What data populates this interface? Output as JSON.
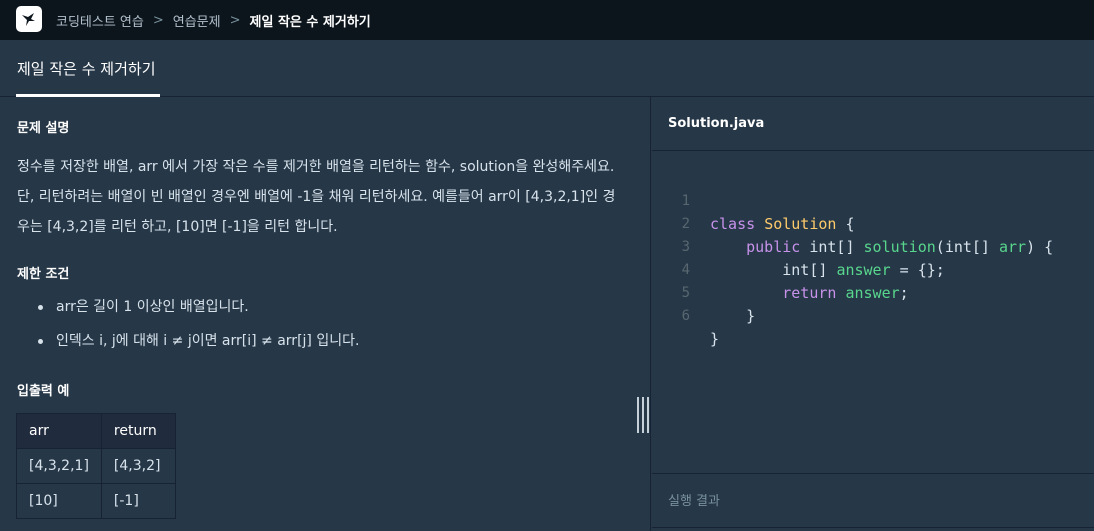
{
  "nav": {
    "breadcrumbs": [
      "코딩테스트 연습",
      "연습문제",
      "제일 작은 수 제거하기"
    ],
    "separator": ">"
  },
  "title_tab": "제일 작은 수 제거하기",
  "problem": {
    "description_heading": "문제 설명",
    "description": "정수를 저장한 배열, arr 에서 가장 작은 수를 제거한 배열을 리턴하는 함수, solution을 완성해주세요. 단, 리턴하려는 배열이 빈 배열인 경우엔 배열에 -1을 채워 리턴하세요. 예를들어 arr이 [4,3,2,1]인 경우는 [4,3,2]를 리턴 하고, [10]면 [-1]을 리턴 합니다.",
    "constraints_heading": "제한 조건",
    "constraints": [
      "arr은 길이 1 이상인 배열입니다.",
      "인덱스 i, j에 대해 i ≠ j이면 arr[i] ≠ arr[j] 입니다."
    ],
    "examples_heading": "입출력 예",
    "examples_table": {
      "headers": [
        "arr",
        "return"
      ],
      "rows": [
        [
          "[4,3,2,1]",
          "[4,3,2]"
        ],
        [
          "[10]",
          "[-1]"
        ]
      ]
    }
  },
  "editor": {
    "filename": "Solution.java",
    "line_numbers": [
      "1",
      "2",
      "3",
      "4",
      "5",
      "6"
    ],
    "tokens": {
      "l1": [
        "class",
        " ",
        "Solution",
        " {"
      ],
      "l2": [
        "    ",
        "public",
        " ",
        "int[]",
        " ",
        "solution",
        "(",
        "int[]",
        " ",
        "arr",
        ") {"
      ],
      "l3": [
        "        ",
        "int[]",
        " ",
        "answer",
        " = {};"
      ],
      "l4": [
        "        ",
        "return",
        " ",
        "answer",
        ";"
      ],
      "l5": [
        "    }"
      ],
      "l6": [
        "}"
      ]
    },
    "colors": {
      "keyword": "#c792ea",
      "class_name": "#ffcb6b",
      "function": "#82aaff",
      "identifier": "#58d68d"
    }
  },
  "result": {
    "label": "실행 결과"
  },
  "theme": {
    "navbar_bg": "#0c151c",
    "panel_bg": "#263747",
    "border": "#172334",
    "table_header_bg": "#202b3d"
  }
}
